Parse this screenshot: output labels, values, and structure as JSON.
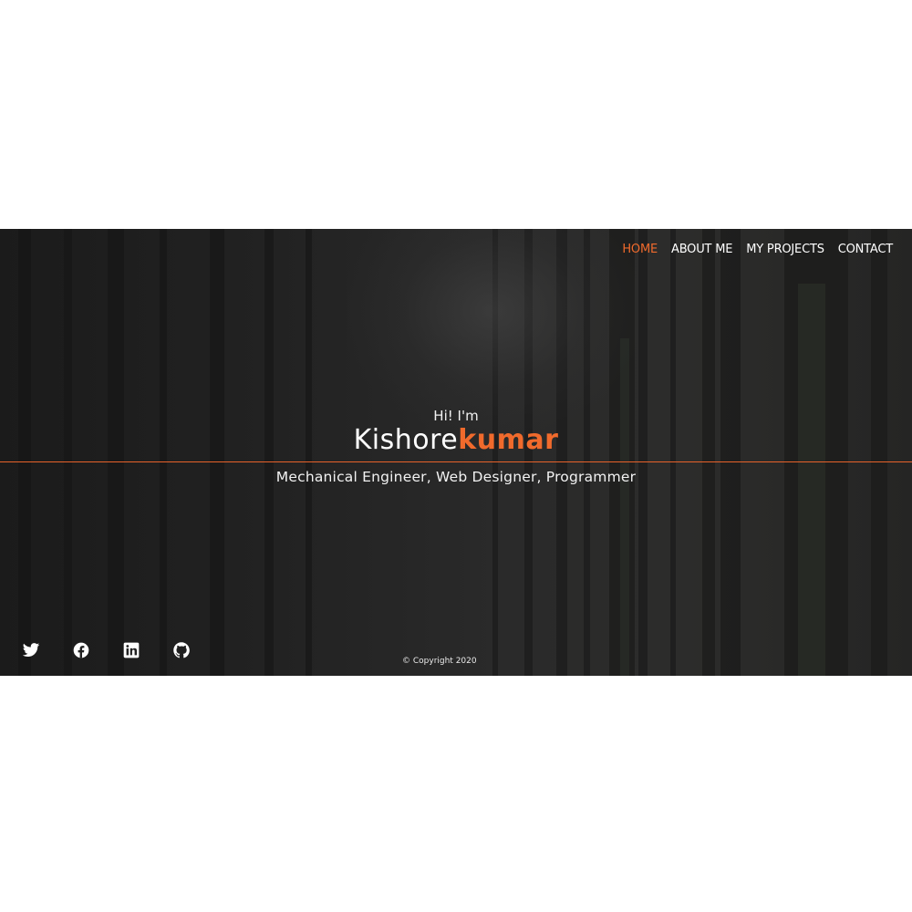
{
  "nav": {
    "items": [
      {
        "label": "HOME",
        "active": true
      },
      {
        "label": "ABOUT ME",
        "active": false
      },
      {
        "label": "MY PROJECTS",
        "active": false
      },
      {
        "label": "CONTACT",
        "active": false
      }
    ]
  },
  "hero": {
    "greeting": "Hi! I'm",
    "first_name": "Kishore",
    "last_name": "kumar",
    "subtitle": "Mechanical Engineer, Web Designer, Programmer"
  },
  "social": {
    "icons": [
      "twitter-icon",
      "facebook-icon",
      "linkedin-icon",
      "github-icon"
    ]
  },
  "footer": {
    "copyright": "© Copyright 2020"
  },
  "colors": {
    "accent": "#f06a2c",
    "background": "#222222",
    "text": "#ffffff"
  }
}
